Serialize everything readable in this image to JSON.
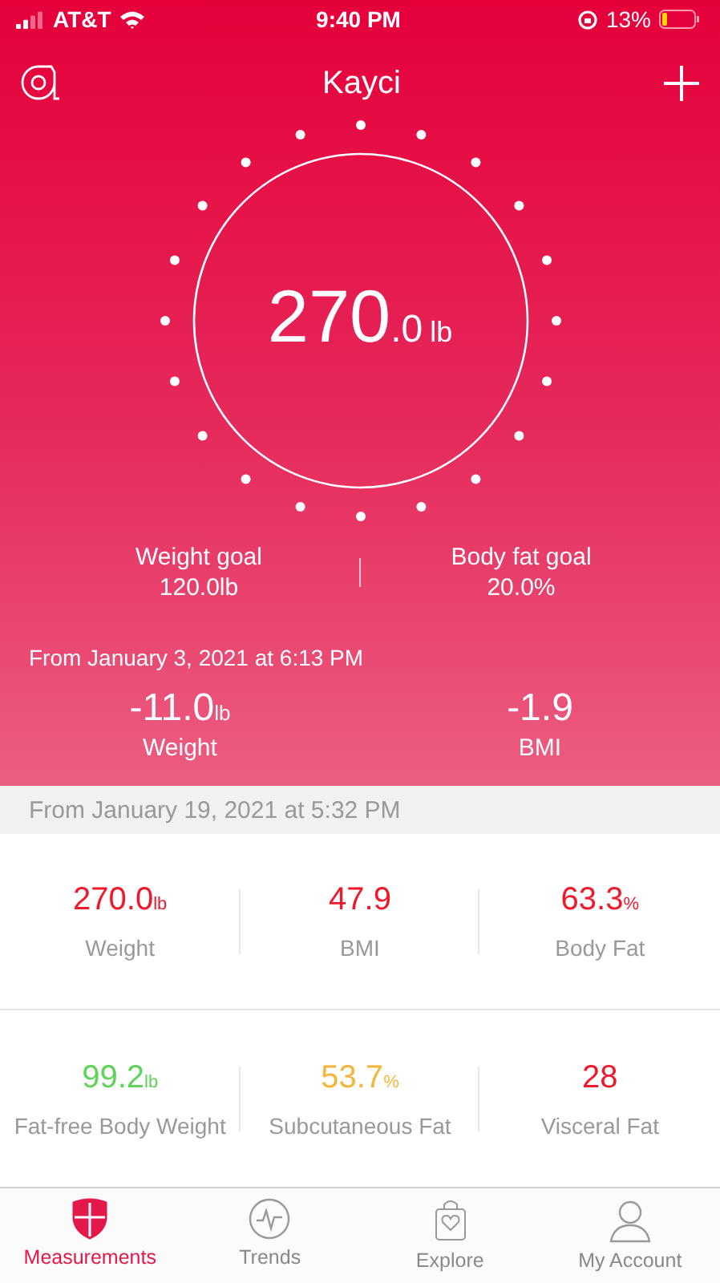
{
  "status_bar": {
    "carrier": "AT&T",
    "time": "9:40 PM",
    "battery": "13%"
  },
  "header": {
    "title": "Kayci"
  },
  "reading": {
    "whole": "270",
    "decimal": ".0",
    "unit": "lb"
  },
  "goals": [
    {
      "label": "Weight goal",
      "value": "120.0lb"
    },
    {
      "label": "Body fat goal",
      "value": "20.0%"
    }
  ],
  "change": {
    "since": "From January 3, 2021 at 6:13 PM",
    "items": [
      {
        "value": "-11.0",
        "unit": "lb",
        "label": "Weight"
      },
      {
        "value": "-1.9",
        "label": "BMI"
      }
    ]
  },
  "latest": {
    "since": "From January 19, 2021 at 5:32 PM",
    "metrics": [
      {
        "value": "270.0",
        "unit": "lb",
        "label": "Weight",
        "color": "#f0192b"
      },
      {
        "value": "47.9",
        "label": "BMI",
        "color": "#f0192b"
      },
      {
        "value": "63.3",
        "unit": "%",
        "label": "Body Fat",
        "color": "#f0192b"
      },
      {
        "value": "99.2",
        "unit": "lb",
        "label": "Fat-free Body Weight",
        "color": "#5fd35a"
      },
      {
        "value": "53.7",
        "unit": "%",
        "label": "Subcutaneous Fat",
        "color": "#f5b53a"
      },
      {
        "value": "28",
        "label": "Visceral Fat",
        "color": "#f0192b"
      }
    ]
  },
  "tabs": [
    {
      "kind": "shield",
      "label": "Measurements",
      "selected": true
    },
    {
      "kind": "pulse",
      "label": "Trends",
      "selected": false
    },
    {
      "kind": "bag",
      "label": "Explore",
      "selected": false
    },
    {
      "kind": "person",
      "label": "My Account",
      "selected": false
    }
  ]
}
